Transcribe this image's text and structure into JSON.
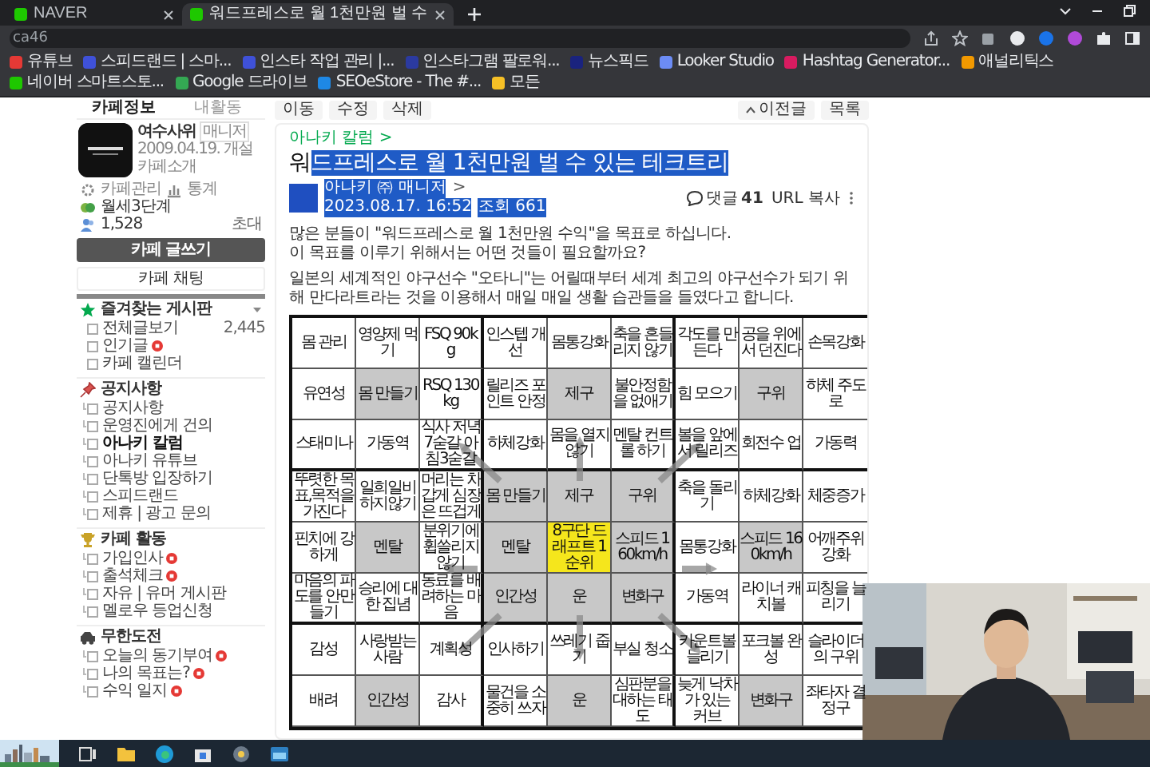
{
  "browser": {
    "tabs": [
      {
        "title": "NAVER",
        "selected": false
      },
      {
        "title": "워드프레스로 월 1천만원 벌 수",
        "selected": true
      }
    ],
    "address": "ca46",
    "bookmarks": [
      {
        "label": "유튜브",
        "color": "#e53935"
      },
      {
        "label": "스피드랜드 | 스마...",
        "color": "#3f51d8"
      },
      {
        "label": "인스타 작업 관리 |...",
        "color": "#3f51d8"
      },
      {
        "label": "인스타그램 팔로워...",
        "color": "#2b3aa0"
      },
      {
        "label": "뉴스픽드",
        "color": "#1a237e"
      },
      {
        "label": "Looker Studio",
        "color": "#6c8cf5"
      },
      {
        "label": "Hashtag Generator...",
        "color": "#d81b60"
      },
      {
        "label": "애널리틱스",
        "color": "#f29900"
      },
      {
        "label": "네이버 스마트스토...",
        "color": "#1ec800"
      },
      {
        "label": "Google 드라이브",
        "color": "#34a853"
      },
      {
        "label": "SEOeStore - The #...",
        "color": "#1e88e5"
      },
      {
        "label": "모든",
        "color": "#f6c026"
      }
    ]
  },
  "toolbar": {
    "left": [
      "이동",
      "수정",
      "삭제"
    ],
    "previous": "이전글",
    "list": "목록"
  },
  "sidebar": {
    "tabs": [
      {
        "label": "카페정보",
        "selected": true
      },
      {
        "label": "내활동",
        "selected": false
      }
    ],
    "cafe": {
      "name": "여수사위",
      "role": "매니저",
      "founded": "2009.04.19. 개설",
      "intro": "카페소개",
      "manage": "카페관리",
      "stats": "통계",
      "rank": "월세3단계",
      "members": "1,528",
      "invite": "초대"
    },
    "write_button": "카페 글쓰기",
    "chat_button": "카페 채팅",
    "sections": [
      {
        "title": "즐겨찾는 게시판",
        "kind": "favorites",
        "items": [
          {
            "label": "전체글보기",
            "count": "2,445",
            "selected": false,
            "new": false
          },
          {
            "label": "인기글",
            "selected": false,
            "new": true
          },
          {
            "label": "카페 캘린더",
            "selected": false,
            "new": false
          }
        ]
      },
      {
        "title": "공지사항",
        "kind": "notice",
        "items": [
          {
            "label": "공지사항",
            "selected": false,
            "new": false
          },
          {
            "label": "운영진에게 건의",
            "selected": false,
            "new": false
          },
          {
            "label": "아나키 칼럼",
            "selected": true,
            "new": false
          },
          {
            "label": "아나키 유튜브",
            "selected": false,
            "new": false
          },
          {
            "label": "단톡방 입장하기",
            "selected": false,
            "new": false
          },
          {
            "label": "스피드랜드",
            "selected": false,
            "new": false
          },
          {
            "label": "제휴 | 광고 문의",
            "selected": false,
            "new": false
          }
        ]
      },
      {
        "title": "카페 활동",
        "kind": "activity",
        "items": [
          {
            "label": "가입인사",
            "selected": false,
            "new": true
          },
          {
            "label": "출석체크",
            "selected": false,
            "new": true
          },
          {
            "label": "자유 | 유머 게시판",
            "selected": false,
            "new": false
          },
          {
            "label": "멜로우 등업신청",
            "selected": false,
            "new": false
          }
        ]
      },
      {
        "title": "무한도전",
        "kind": "challenge",
        "items": [
          {
            "label": "오늘의 동기부여",
            "selected": false,
            "new": true
          },
          {
            "label": "나의 목표는?",
            "selected": false,
            "new": true
          },
          {
            "label": "수익 일지",
            "selected": false,
            "new": true
          }
        ]
      }
    ]
  },
  "article": {
    "breadcrumb": "아나키 칼럼 >",
    "title": {
      "plain": "워",
      "selected": "드프레스로 월 1천만원 벌 수 있는 테크트리"
    },
    "meta": {
      "selected": true,
      "author": "아나키 ㈜ 매니저",
      "author_arrow": ">",
      "date": "2023.08.17. 16:52",
      "views": "조회 661"
    },
    "comments_label": "댓글",
    "comments": "41",
    "url_copy": "URL 복사",
    "paragraphs": [
      {
        "lines": [
          "많은 분들이 \"워드프레스로 월 1천만원 수익\"을 목표로 하십니다.",
          "이 목표를 이루기 위해서는 어떤 것들이 필요할까요?"
        ]
      },
      {
        "lines": [
          "일본의 세계적인 야구선수 \"오타니\"는 어릴때부터 세계 최고의 야구선수가 되기 위해 만다라트라는 것을 이용해서 매일 매일 생활 습관들을 들였다고 합니다."
        ]
      }
    ],
    "mandala": {
      "rows": [
        [
          {
            "text": "몸 관리",
            "kind": "item"
          },
          {
            "text": "영양제 먹기",
            "kind": "item"
          },
          {
            "text": "FSQ 90kg",
            "kind": "item"
          },
          {
            "text": "인스텝 개선",
            "kind": "item"
          },
          {
            "text": "몸통강화",
            "kind": "item"
          },
          {
            "text": "축을 흔들리지 않기",
            "kind": "item"
          },
          {
            "text": "각도를 만든다",
            "kind": "item"
          },
          {
            "text": "공을 위에서 던진다",
            "kind": "item"
          },
          {
            "text": "손목강화",
            "kind": "item"
          }
        ],
        [
          {
            "text": "유연성",
            "kind": "item"
          },
          {
            "text": "몸 만들기",
            "kind": "theme"
          },
          {
            "text": "RSQ 130kg",
            "kind": "item"
          },
          {
            "text": "릴리즈 포인트 안정",
            "kind": "item"
          },
          {
            "text": "제구",
            "kind": "theme"
          },
          {
            "text": "불안정함을 없애기",
            "kind": "item"
          },
          {
            "text": "힘 모으기",
            "kind": "item"
          },
          {
            "text": "구위",
            "kind": "theme"
          },
          {
            "text": "하체 주도로",
            "kind": "item"
          }
        ],
        [
          {
            "text": "스태미나",
            "kind": "item"
          },
          {
            "text": "가동역",
            "kind": "item"
          },
          {
            "text": "식사 저녁7숟갈 아침3숟갈",
            "kind": "item"
          },
          {
            "text": "하체강화",
            "kind": "item"
          },
          {
            "text": "몸을 열지않기",
            "kind": "item"
          },
          {
            "text": "멘탈 컨트롤 하기",
            "kind": "item"
          },
          {
            "text": "볼을 앞에서 릴리즈",
            "kind": "item"
          },
          {
            "text": "회전수 업",
            "kind": "item"
          },
          {
            "text": "가동력",
            "kind": "item"
          }
        ],
        [
          {
            "text": "뚜렷한 목표,목적을 가진다",
            "kind": "item"
          },
          {
            "text": "일희일비 하지않기",
            "kind": "item"
          },
          {
            "text": "머리는 차갑게 심장은 뜨겁게",
            "kind": "item"
          },
          {
            "text": "몸 만들기",
            "kind": "theme"
          },
          {
            "text": "제구",
            "kind": "theme"
          },
          {
            "text": "구위",
            "kind": "theme"
          },
          {
            "text": "축을 돌리기",
            "kind": "item"
          },
          {
            "text": "하체강화",
            "kind": "item"
          },
          {
            "text": "체중증가",
            "kind": "item"
          }
        ],
        [
          {
            "text": "핀치에 강하게",
            "kind": "item"
          },
          {
            "text": "멘탈",
            "kind": "theme"
          },
          {
            "text": "분위기에 휩쓸리지 않기",
            "kind": "item"
          },
          {
            "text": "멘탈",
            "kind": "theme"
          },
          {
            "text": "8구단 드래프트 1순위",
            "kind": "goal"
          },
          {
            "text": "스피드 160km/h",
            "kind": "theme"
          },
          {
            "text": "몸통강화",
            "kind": "item"
          },
          {
            "text": "스피드 160km/h",
            "kind": "theme"
          },
          {
            "text": "어깨주위 강화",
            "kind": "item"
          }
        ],
        [
          {
            "text": "마음의 파도를 안만들기",
            "kind": "item"
          },
          {
            "text": "승리에 대한 집념",
            "kind": "item"
          },
          {
            "text": "동료를 배려하는 마음",
            "kind": "item"
          },
          {
            "text": "인간성",
            "kind": "theme"
          },
          {
            "text": "운",
            "kind": "theme"
          },
          {
            "text": "변화구",
            "kind": "theme"
          },
          {
            "text": "가동역",
            "kind": "item"
          },
          {
            "text": "라이너 캐치볼",
            "kind": "item"
          },
          {
            "text": "피칭을 늘리기",
            "kind": "item"
          }
        ],
        [
          {
            "text": "감성",
            "kind": "item"
          },
          {
            "text": "사랑받는 사람",
            "kind": "item"
          },
          {
            "text": "계획성",
            "kind": "item"
          },
          {
            "text": "인사하기",
            "kind": "item"
          },
          {
            "text": "쓰레기 줍기",
            "kind": "item"
          },
          {
            "text": "부실 청소",
            "kind": "item"
          },
          {
            "text": "카운트볼 늘리기",
            "kind": "item"
          },
          {
            "text": "포크볼 완성",
            "kind": "item"
          },
          {
            "text": "슬라이더의 구위",
            "kind": "item"
          }
        ],
        [
          {
            "text": "배려",
            "kind": "item"
          },
          {
            "text": "인간성",
            "kind": "theme"
          },
          {
            "text": "감사",
            "kind": "item"
          },
          {
            "text": "물건을 소중히 쓰자",
            "kind": "item"
          },
          {
            "text": "운",
            "kind": "theme"
          },
          {
            "text": "심판분을 대하는 태도",
            "kind": "item"
          },
          {
            "text": "늦게 낙차가 있는 커브",
            "kind": "item"
          },
          {
            "text": "변화구",
            "kind": "theme"
          },
          {
            "text": "좌타자 결정구",
            "kind": "item"
          }
        ]
      ]
    }
  }
}
